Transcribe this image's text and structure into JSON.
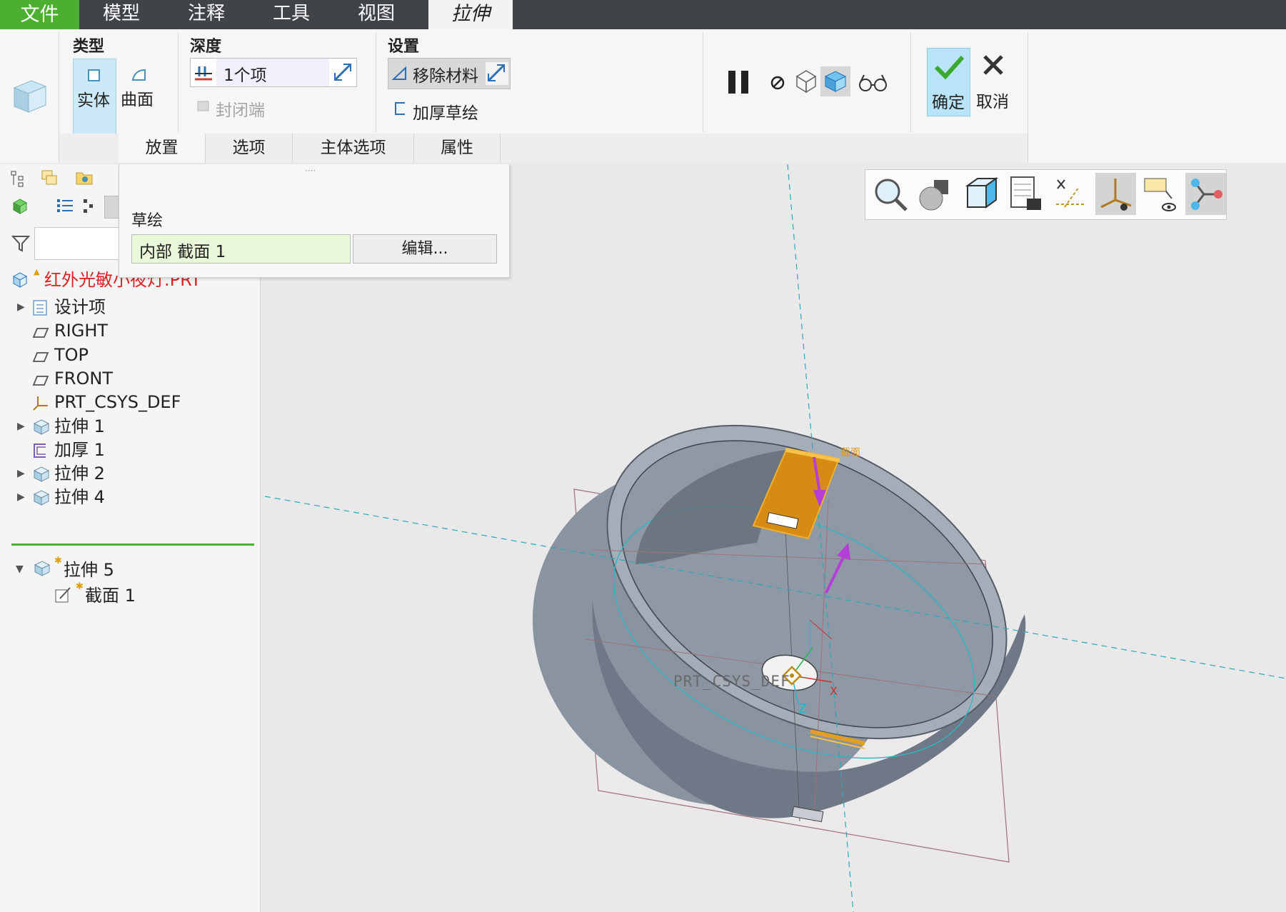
{
  "menu": {
    "file": "文件",
    "model": "模型",
    "annotate": "注释",
    "tools": "工具",
    "view": "视图",
    "active_tab": "拉伸"
  },
  "ribbon": {
    "type": {
      "label": "类型",
      "solid": "实体",
      "surface": "曲面"
    },
    "depth": {
      "label": "深度",
      "value": "1个项",
      "capped_ends": "封闭端"
    },
    "settings": {
      "label": "设置",
      "remove_material": "移除材料",
      "thicken_sketch": "加厚草绘"
    },
    "ok": "确定",
    "cancel": "取消",
    "tabs": [
      "放置",
      "选项",
      "主体选项",
      "属性"
    ]
  },
  "placement_panel": {
    "sketch_label": "草绘",
    "sketch_value": "内部 截面 1",
    "edit_button": "编辑..."
  },
  "model_tree": {
    "root": "红外光敏小夜灯.PRT",
    "items": [
      {
        "label": "设计项",
        "icon": "design-items-icon",
        "expandable": true
      },
      {
        "label": "RIGHT",
        "icon": "datum-plane-icon",
        "expandable": false
      },
      {
        "label": "TOP",
        "icon": "datum-plane-icon",
        "expandable": false
      },
      {
        "label": "FRONT",
        "icon": "datum-plane-icon",
        "expandable": false
      },
      {
        "label": "PRT_CSYS_DEF",
        "icon": "csys-icon",
        "expandable": false
      },
      {
        "label": "拉伸 1",
        "icon": "extrude-icon",
        "expandable": true
      },
      {
        "label": "加厚 1",
        "icon": "thicken-icon",
        "expandable": false
      },
      {
        "label": "拉伸 2",
        "icon": "extrude-icon",
        "expandable": true
      },
      {
        "label": "拉伸 4",
        "icon": "extrude-icon",
        "expandable": true
      }
    ],
    "active_feature": "拉伸 5",
    "active_child": "截面 1"
  },
  "viewport": {
    "csys_label": "PRT_CSYS_DEF",
    "z_label": "Z",
    "x_label": "X",
    "section_tag": "截面"
  },
  "view_toolbar": [
    "zoom-icon",
    "display-style-icon",
    "saved-views-icon",
    "view-manager-icon",
    "datum-display-icon",
    "csys-display-icon",
    "annotation-display-icon",
    "spin-center-icon"
  ],
  "colors": {
    "menu_bg": "#3f4448",
    "file_green": "#4caf2f",
    "model_gray": "#7d8794",
    "feature_orange": "#e39a17",
    "arrow_magenta": "#b53ed6",
    "root_red": "#e02020"
  }
}
